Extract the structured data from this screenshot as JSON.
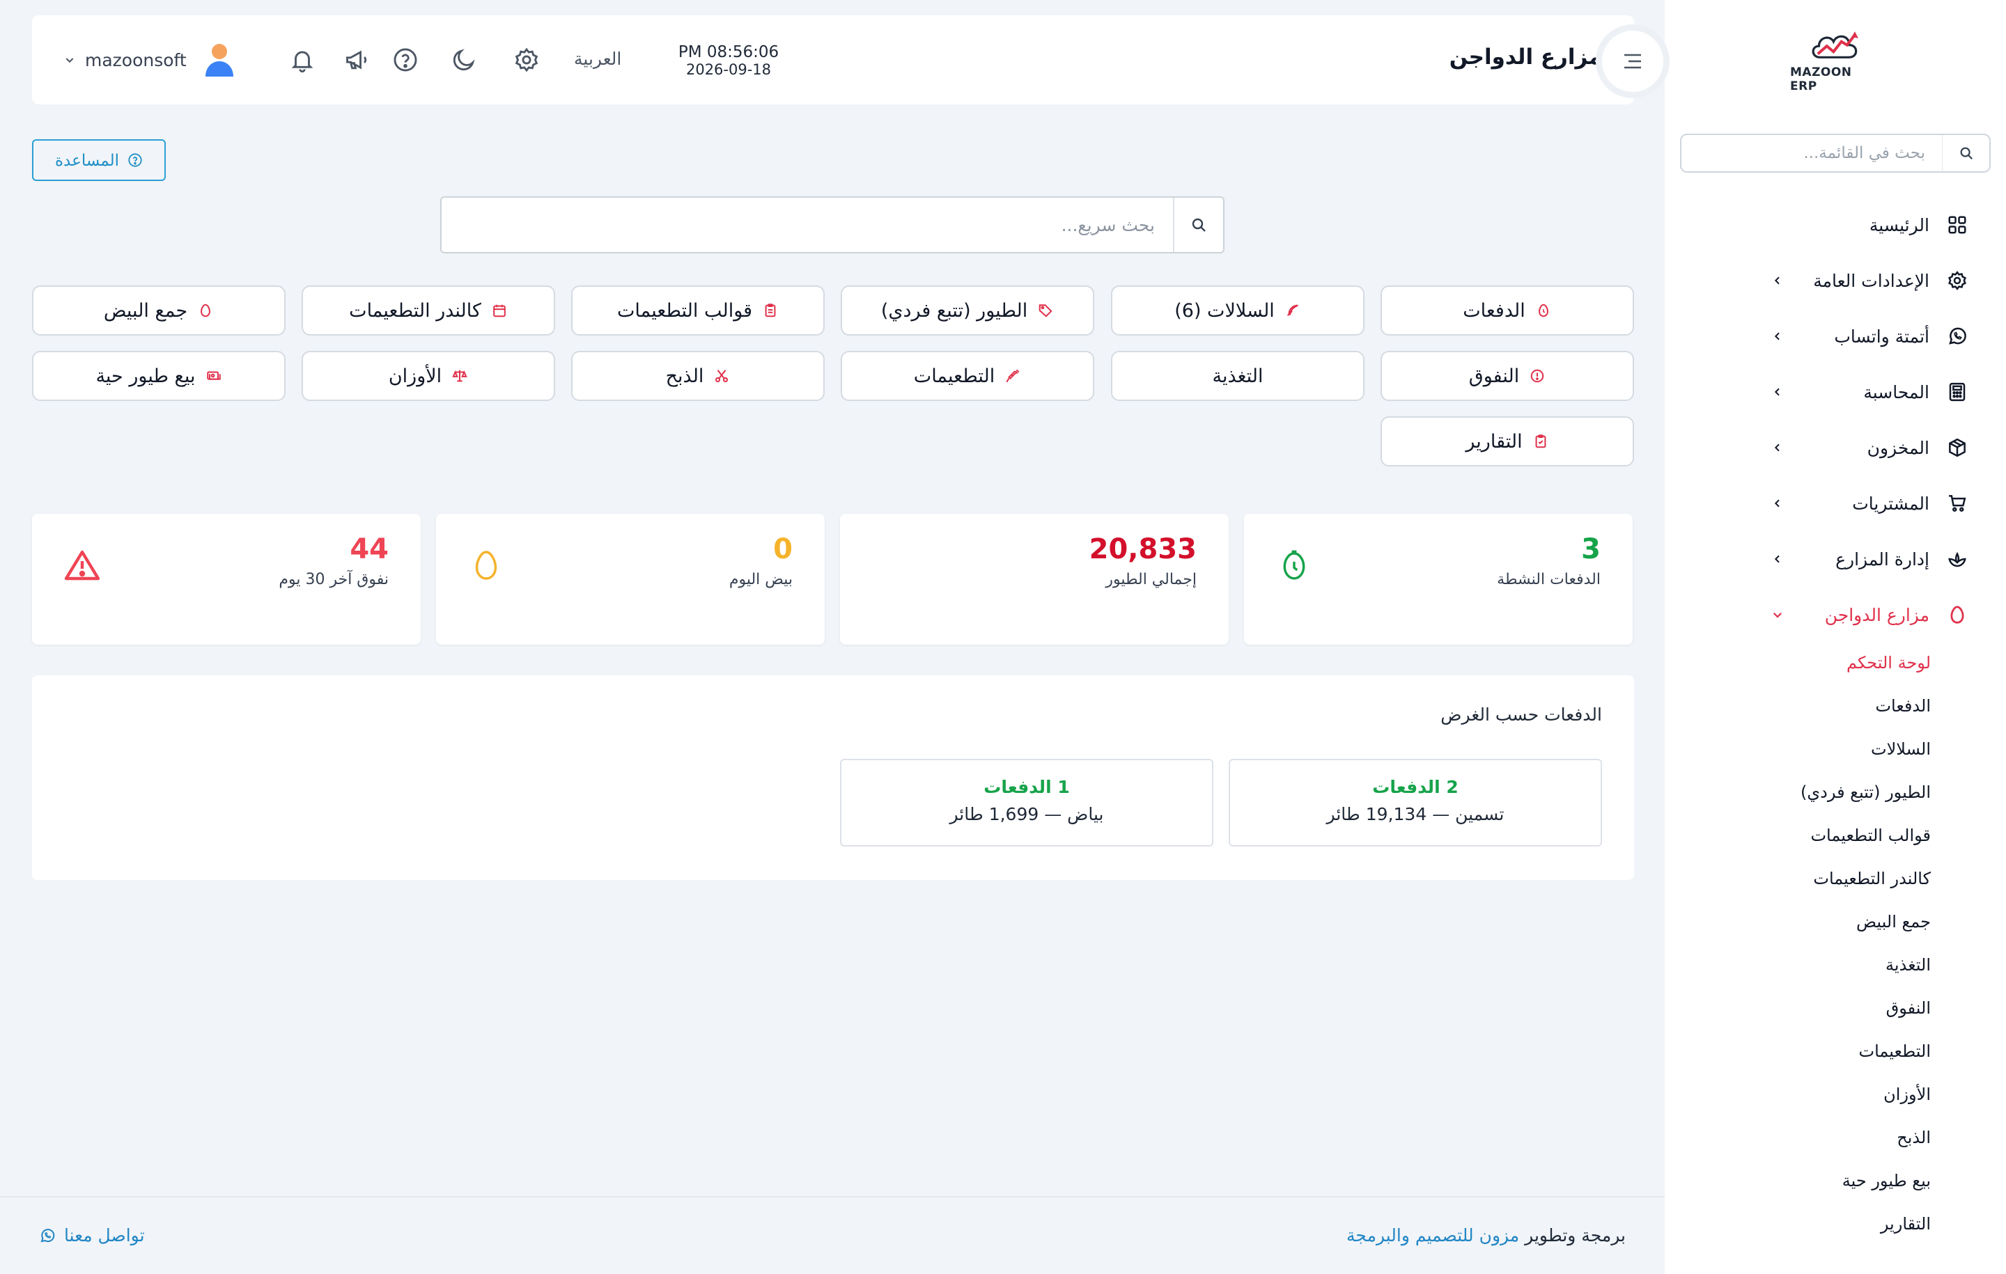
{
  "sidebar": {
    "logo_text": "MAZOON ERP",
    "search_placeholder": "بحث في القائمة...",
    "items": [
      {
        "label": "الرئيسية",
        "icon": "grid-icon"
      },
      {
        "label": "الإعدادات العامة",
        "icon": "gear-icon"
      },
      {
        "label": "أتمتة واتساب",
        "icon": "whatsapp-icon"
      },
      {
        "label": "المحاسبة",
        "icon": "calculator-icon"
      },
      {
        "label": "المخزون",
        "icon": "box-icon"
      },
      {
        "label": "المشتريات",
        "icon": "cart-icon"
      },
      {
        "label": "إدارة المزارع",
        "icon": "plant-icon"
      },
      {
        "label": "مزارع الدواجن",
        "icon": "egg-icon"
      }
    ],
    "subitems": [
      "لوحة التحكم",
      "الدفعات",
      "السلالات",
      "الطيور (تتبع فردي)",
      "قوالب التطعيمات",
      "كالندر التطعيمات",
      "جمع البيض",
      "التغذية",
      "النفوق",
      "التطعيمات",
      "الأوزان",
      "الذبح",
      "بيع طيور حية",
      "التقارير"
    ]
  },
  "header": {
    "page_title": "مزارع الدواجن",
    "time": "PM 08:56:06",
    "date": "2026-09-18",
    "language": "العربية",
    "username": "mazoonsoft"
  },
  "help_label": "المساعدة",
  "quick_search_placeholder": "بحث سريع...",
  "quick_buttons": [
    {
      "label": "الدفعات",
      "icon": "egg-icon"
    },
    {
      "label": "السلالات (6)",
      "icon": "feather-icon"
    },
    {
      "label": "الطيور (تتبع فردي)",
      "icon": "tag-icon"
    },
    {
      "label": "قوالب التطعيمات",
      "icon": "clipboard-icon"
    },
    {
      "label": "كالندر التطعيمات",
      "icon": "calendar-icon"
    },
    {
      "label": "جمع البيض",
      "icon": "egg-icon"
    },
    {
      "label": "النفوق",
      "icon": "alert-circle-icon"
    },
    {
      "label": "التغذية",
      "icon": ""
    },
    {
      "label": "التطعيمات",
      "icon": "syringe-icon"
    },
    {
      "label": "الذبح",
      "icon": "scissors-icon"
    },
    {
      "label": "الأوزان",
      "icon": "scale-icon"
    },
    {
      "label": "بيع طيور حية",
      "icon": "money-icon"
    },
    {
      "label": "التقارير",
      "icon": "clipboard-icon"
    }
  ],
  "stats": [
    {
      "value": "3",
      "label": "الدفعات النشطة",
      "color": "#16a34a",
      "icon": "clock-icon"
    },
    {
      "value": "20,833",
      "label": "إجمالي الطيور",
      "color": "#d3102b",
      "icon": ""
    },
    {
      "value": "0",
      "label": "بيض اليوم",
      "color": "#f5b32c",
      "icon": "egg-icon"
    },
    {
      "value": "44",
      "label": "نفوق آخر 30 يوم",
      "color": "#ef4454",
      "icon": "warning-icon"
    }
  ],
  "batches_panel": {
    "title": "الدفعات حسب الغرض",
    "boxes": [
      {
        "title": "2 الدفعات",
        "subtitle": "تسمين — 19,134 طائر"
      },
      {
        "title": "1 الدفعات",
        "subtitle": "بياض — 1,699 طائر"
      }
    ]
  },
  "footer": {
    "credit_prefix": "برمجة وتطوير ",
    "credit_link": "مزون للتصميم والبرمجة",
    "contact": "تواصل معنا"
  },
  "colors": {
    "accent": "#e0314b",
    "help": "#1f8fc6",
    "success": "#16a34a"
  }
}
